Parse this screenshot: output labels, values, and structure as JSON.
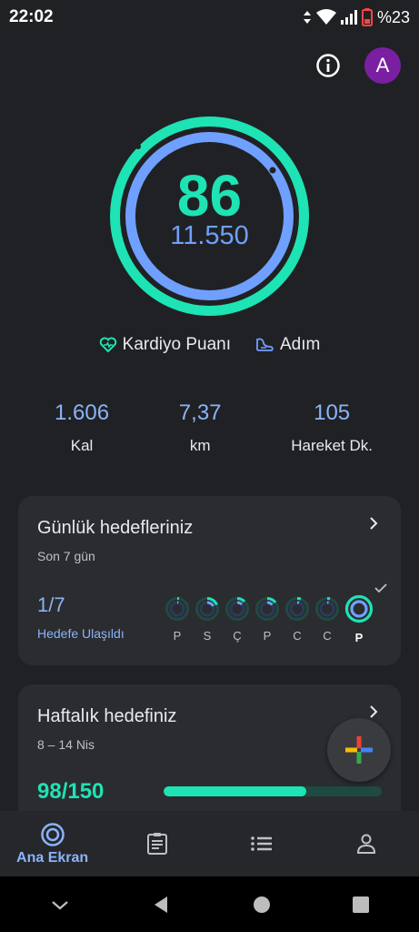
{
  "status_bar": {
    "time": "22:02",
    "battery": "%23"
  },
  "header": {
    "avatar_letter": "A"
  },
  "ring": {
    "main_value": "86",
    "sub_value": "11.550",
    "outer_color": "#1ee3b4",
    "inner_color": "#6fa0ff"
  },
  "metrics": {
    "heart_label": "Kardiyo Puanı",
    "steps_label": "Adım"
  },
  "stats": [
    {
      "value": "1.606",
      "label": "Kal"
    },
    {
      "value": "7,37",
      "label": "km"
    },
    {
      "value": "105",
      "label": "Hareket Dk."
    }
  ],
  "daily_goals": {
    "title": "Günlük hedefleriniz",
    "subtitle": "Son 7 gün",
    "count": "1/7",
    "note": "Hedefe Ulaşıldı",
    "days": [
      "P",
      "S",
      "Ç",
      "P",
      "C",
      "C",
      "P"
    ]
  },
  "weekly_goal": {
    "title": "Haftalık hedefiniz",
    "subtitle": "8 – 14 Nis",
    "count": "98/150",
    "progress_fraction": 0.653
  },
  "bottom_nav": [
    {
      "label": "Ana Ekran",
      "icon": "home-ring-icon"
    },
    {
      "label": "",
      "icon": "journal-icon"
    },
    {
      "label": "",
      "icon": "browse-list-icon"
    },
    {
      "label": "",
      "icon": "profile-icon"
    }
  ]
}
